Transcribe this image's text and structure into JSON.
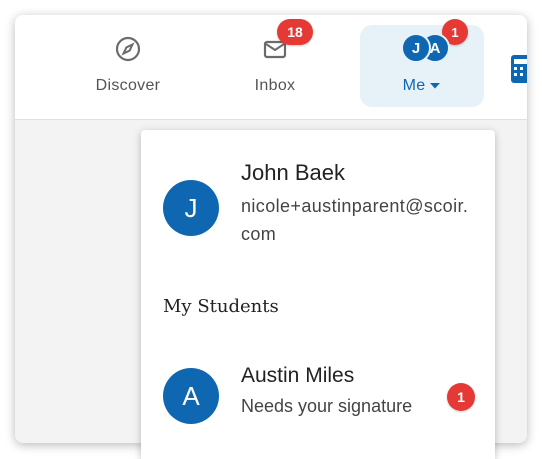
{
  "nav": {
    "discover": {
      "label": "Discover",
      "icon": "compass-icon"
    },
    "inbox": {
      "label": "Inbox",
      "icon": "mail-icon",
      "badge": "18"
    },
    "me": {
      "label": "Me",
      "avatar_initials": [
        "J",
        "A"
      ],
      "badge": "1"
    }
  },
  "dropdown": {
    "user": {
      "initial": "J",
      "name": "John Baek",
      "email": "nicole+austinparent@scoir.com"
    },
    "section_title": "My Students",
    "students": [
      {
        "initial": "A",
        "name": "Austin Miles",
        "status": "Needs your signature",
        "badge": "1"
      }
    ]
  },
  "colors": {
    "brand": "#0f67b1",
    "badge": "#e53935",
    "selected_bg": "#e7f2f8"
  }
}
